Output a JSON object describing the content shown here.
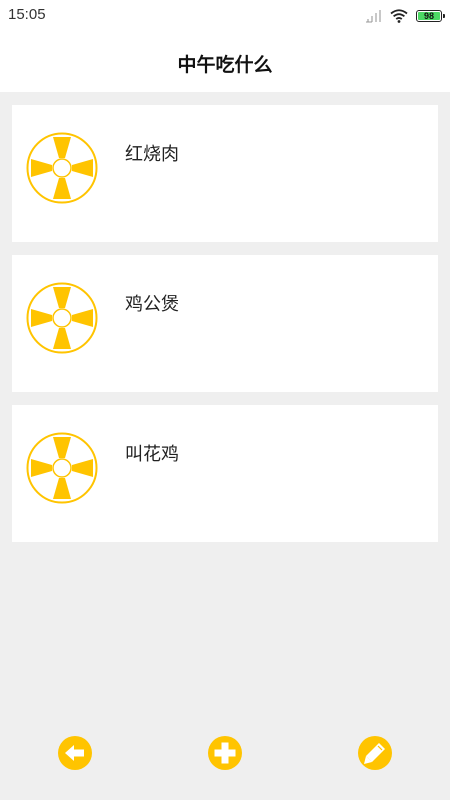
{
  "status_bar": {
    "time": "15:05",
    "battery": "98",
    "battery_level": 0.98
  },
  "header": {
    "title": "中午吃什么"
  },
  "list": {
    "items": [
      {
        "label": "红烧肉",
        "icon": "wheel-icon"
      },
      {
        "label": "鸡公煲",
        "icon": "wheel-icon"
      },
      {
        "label": "叫花鸡",
        "icon": "wheel-icon"
      }
    ]
  },
  "bottom_bar": {
    "buttons": [
      {
        "icon": "arrow-left-icon"
      },
      {
        "icon": "plus-icon"
      },
      {
        "icon": "pencil-icon"
      }
    ]
  },
  "colors": {
    "accent": "#FFC400",
    "accent_dark": "#F5B700",
    "background": "#EFEFEF",
    "card": "#FFFFFF",
    "battery_fill": "#4CD964"
  }
}
